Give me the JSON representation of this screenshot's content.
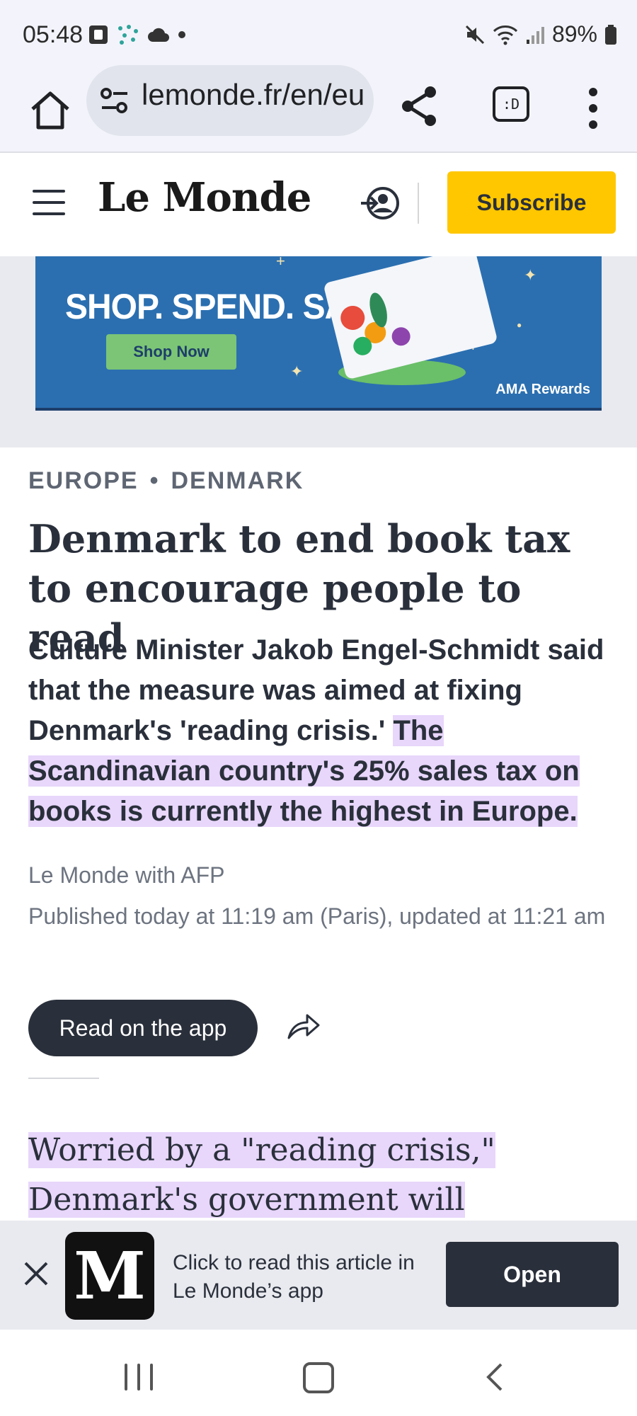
{
  "status_bar": {
    "time": "05:48",
    "battery": "89%",
    "icons": [
      "sim-icon",
      "dots-icon",
      "cloud-icon",
      "dot-icon",
      "mute-icon",
      "wifi-icon",
      "signal-icon",
      "battery-icon"
    ]
  },
  "browser": {
    "url": "lemonde.fr/en/eu",
    "tabs_label": ":D"
  },
  "header": {
    "logo": "Le Monde",
    "subscribe_label": "Subscribe"
  },
  "ad": {
    "headline": "SHOP. SPEND. SAVE.",
    "button_label": "Shop Now",
    "brand": "AMA Rewards"
  },
  "article": {
    "kicker_primary": "EUROPE",
    "kicker_separator": "•",
    "kicker_secondary": "DENMARK",
    "headline": "Denmark to end book tax to encourage people to read",
    "dek_plain": "Culture Minister Jakob Engel-Schmidt said that the measure was aimed at fixing Denmark's 'reading crisis.' ",
    "dek_highlighted": "The Scandinavian country's 25% sales tax on books is currently the highest in Europe.",
    "byline": "Le Monde with AFP",
    "published": "Published today at 11:19 am (Paris), updated at 11:21 am",
    "read_app_label": "Read on the app",
    "body_highlighted": "Worried by a \"reading crisis,\" Denmark's government will eliminate its sales tax"
  },
  "app_banner": {
    "logo_letter": "M",
    "text": "Click to read this article in Le Monde’s app",
    "open_label": "Open"
  }
}
